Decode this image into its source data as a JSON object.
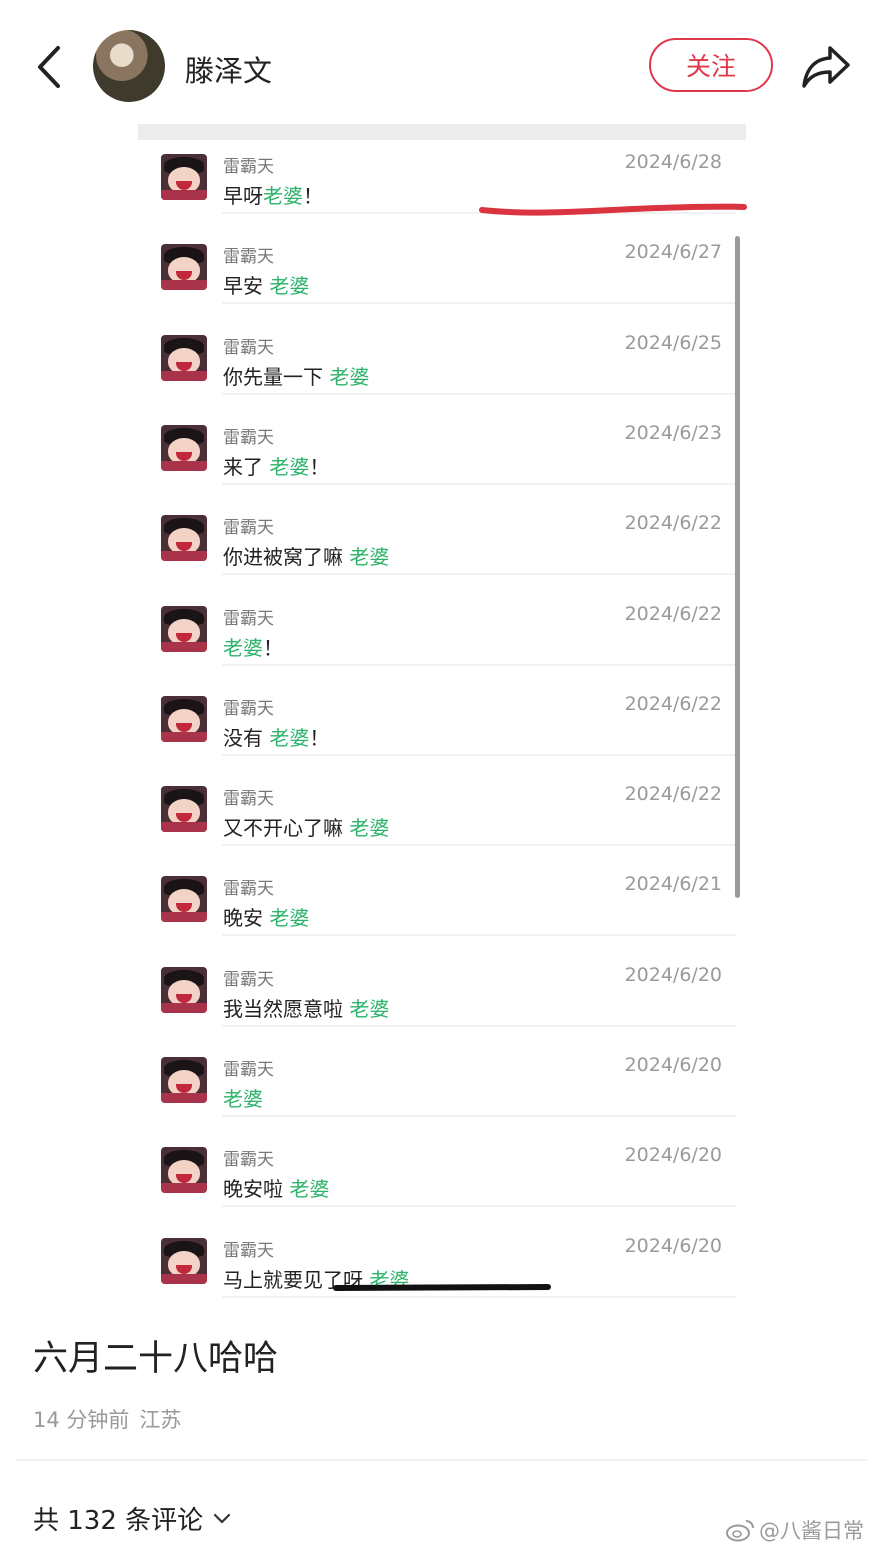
{
  "header": {
    "username": "滕泽文",
    "follow_label": "关注"
  },
  "messages": [
    {
      "sender": "雷霸天",
      "date": "2024/6/28",
      "prefix": "早呀",
      "keyword": "老婆",
      "suffix": "！"
    },
    {
      "sender": "雷霸天",
      "date": "2024/6/27",
      "prefix": "早安 ",
      "keyword": "老婆",
      "suffix": ""
    },
    {
      "sender": "雷霸天",
      "date": "2024/6/25",
      "prefix": "你先量一下 ",
      "keyword": "老婆",
      "suffix": ""
    },
    {
      "sender": "雷霸天",
      "date": "2024/6/23",
      "prefix": "来了 ",
      "keyword": "老婆",
      "suffix": "！"
    },
    {
      "sender": "雷霸天",
      "date": "2024/6/22",
      "prefix": "你进被窝了嘛 ",
      "keyword": "老婆",
      "suffix": ""
    },
    {
      "sender": "雷霸天",
      "date": "2024/6/22",
      "prefix": "",
      "keyword": "老婆",
      "suffix": "！"
    },
    {
      "sender": "雷霸天",
      "date": "2024/6/22",
      "prefix": "没有 ",
      "keyword": "老婆",
      "suffix": "！"
    },
    {
      "sender": "雷霸天",
      "date": "2024/6/22",
      "prefix": "又不开心了嘛 ",
      "keyword": "老婆",
      "suffix": ""
    },
    {
      "sender": "雷霸天",
      "date": "2024/6/21",
      "prefix": "晚安 ",
      "keyword": "老婆",
      "suffix": ""
    },
    {
      "sender": "雷霸天",
      "date": "2024/6/20",
      "prefix": "我当然愿意啦 ",
      "keyword": "老婆",
      "suffix": ""
    },
    {
      "sender": "雷霸天",
      "date": "2024/6/20",
      "prefix": "",
      "keyword": "老婆",
      "suffix": ""
    },
    {
      "sender": "雷霸天",
      "date": "2024/6/20",
      "prefix": "晚安啦 ",
      "keyword": "老婆",
      "suffix": ""
    },
    {
      "sender": "雷霸天",
      "date": "2024/6/20",
      "prefix": "马上就要见了呀 ",
      "keyword": "老婆",
      "suffix": ""
    }
  ],
  "post": {
    "title": "六月二十八哈哈",
    "time_ago": "14 分钟前",
    "location": "江苏"
  },
  "comments": {
    "label": "共 132 条评论"
  },
  "watermark": {
    "text": "@八酱日常"
  },
  "colors": {
    "accent_red": "#e0384b",
    "keyword_green": "#2bb36a"
  }
}
